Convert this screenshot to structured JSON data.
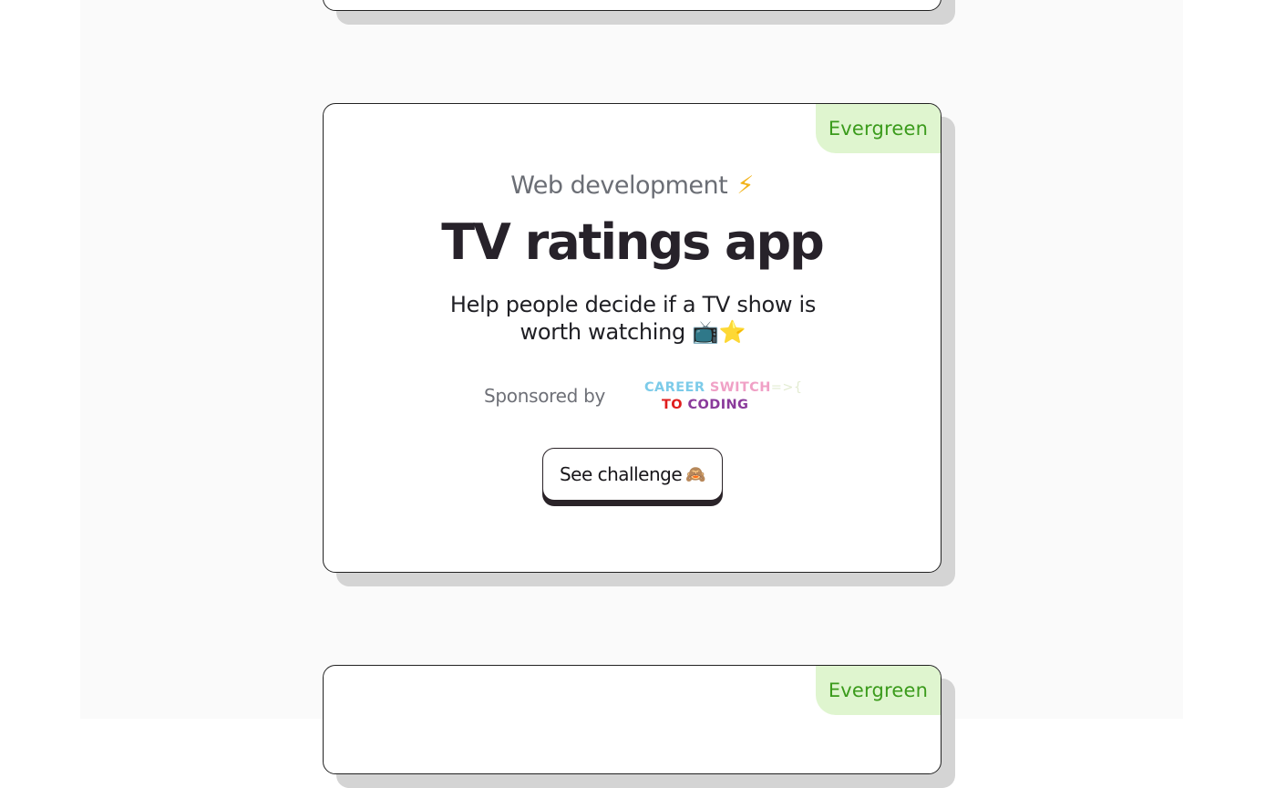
{
  "cards": {
    "top": {
      "badge": ""
    },
    "main": {
      "badge": "Evergreen",
      "category": "Web development",
      "category_icon": "⚡",
      "title": "TV ratings app",
      "description": "Help people decide if a TV show is worth watching 📺⭐",
      "sponsor_label": "Sponsored by",
      "sponsor_logo": {
        "line1_a": "CAREER",
        "line1_b": "SWITCH",
        "line1_c": "=>{",
        "line2_a": "TO",
        "line2_b": "CODING"
      },
      "button_label": "See challenge",
      "button_icon": "🙈"
    },
    "bottom": {
      "badge": "Evergreen"
    }
  },
  "colors": {
    "badge_bg": "#dff5cf",
    "badge_text": "#3b9b1c",
    "title": "#27222a",
    "card_border": "#222222",
    "card_shadow": "#d4d4d4"
  }
}
